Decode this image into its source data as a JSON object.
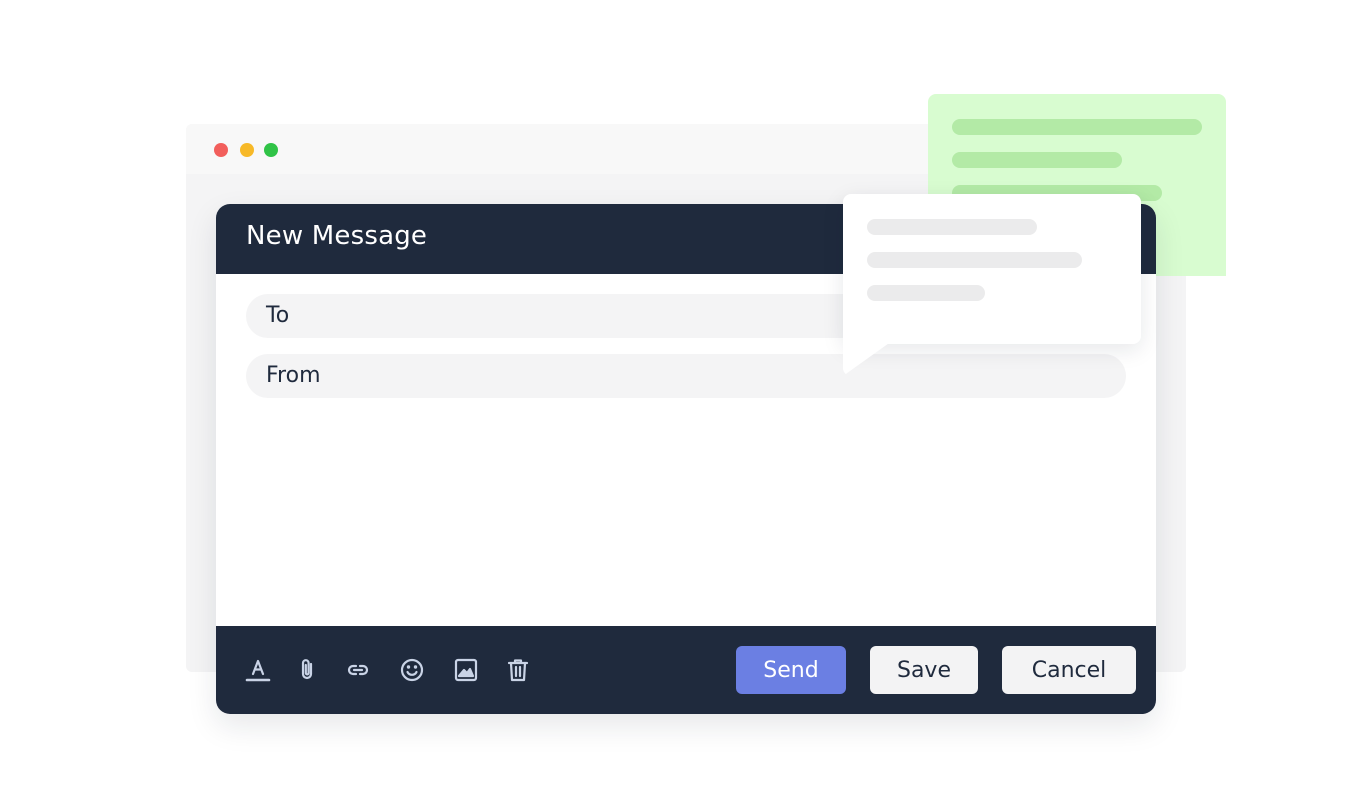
{
  "colors": {
    "navy": "#1f2a3d",
    "send_button": "#6b7fe3",
    "mac_red": "#f25f5c",
    "mac_yellow": "#f7b928",
    "mac_green": "#30c347",
    "green_bubble": "#d8fcd0",
    "green_line": "#b3eaa6",
    "toolbar_icon": "#c9d3e6"
  },
  "window_controls": {
    "close": "red-dot",
    "minimize": "yellow-dot",
    "maximize": "green-dot"
  },
  "compose": {
    "title": "New Message",
    "to_label": "To",
    "from_label": "From",
    "toolbar": {
      "icons": [
        "text-format-icon",
        "attachment-icon",
        "link-icon",
        "emoji-icon",
        "image-icon",
        "trash-icon"
      ]
    },
    "buttons": {
      "send": "Send",
      "save": "Save",
      "cancel": "Cancel"
    }
  }
}
